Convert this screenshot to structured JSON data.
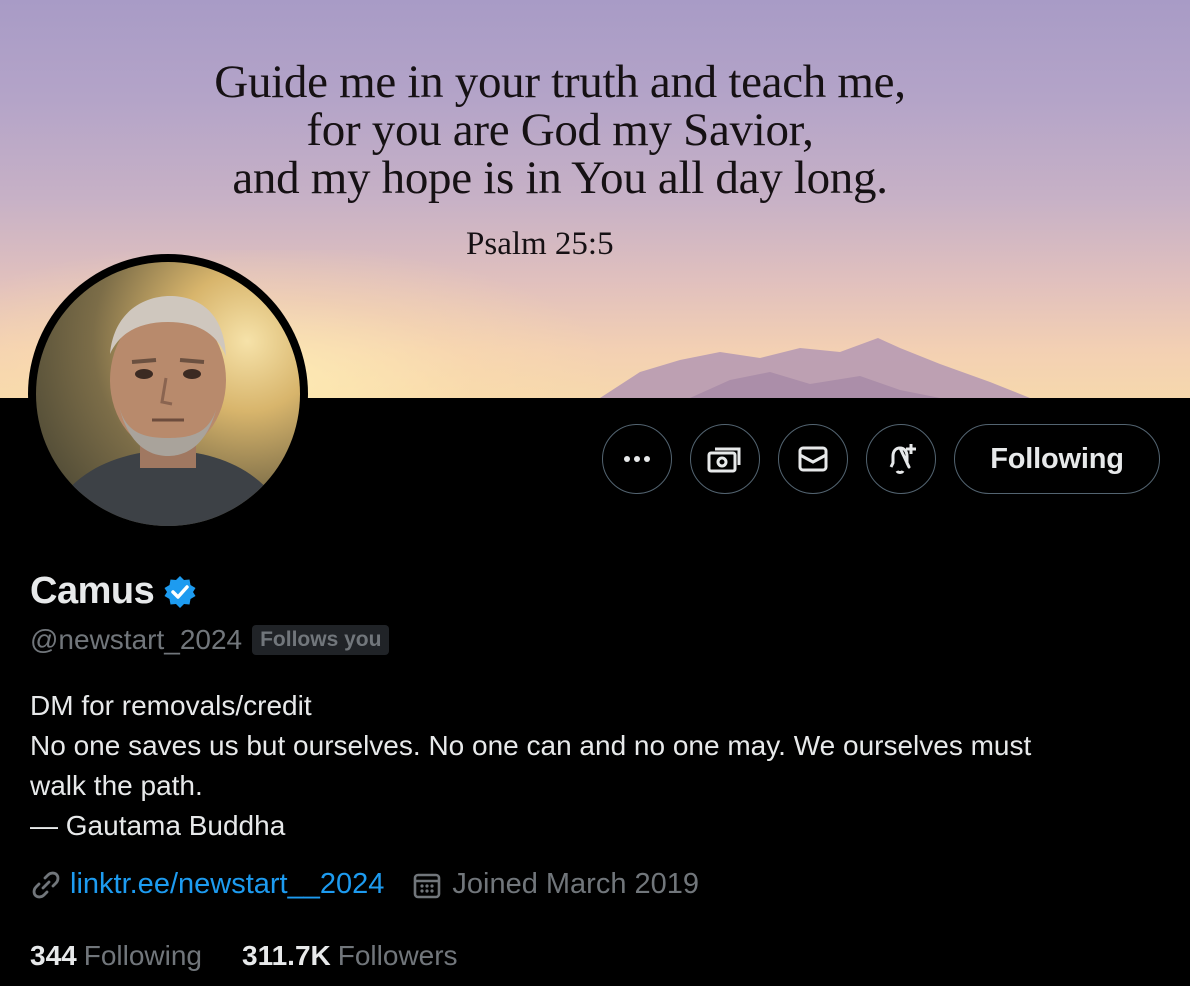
{
  "banner": {
    "quote_lines": [
      "Guide me in your truth and teach me,",
      "for you are God my Savior,",
      "and my hope is in You all day long."
    ],
    "reference": "Psalm 25:5"
  },
  "profile": {
    "display_name": "Camus",
    "verified": true,
    "handle": "@newstart_2024",
    "follows_you_badge": "Follows you",
    "bio_lines": [
      "DM for removals/credit",
      "No one saves us but ourselves. No one can and no one may. We ourselves must",
      "walk the path.",
      "— Gautama Buddha"
    ],
    "website": "linktr.ee/newstart__2024",
    "joined": "Joined March 2019"
  },
  "actions": {
    "more_icon": "more-horizontal-icon",
    "subscribe_icon": "money-icon",
    "message_icon": "envelope-icon",
    "notify_icon": "bell-plus-icon",
    "follow_button_label": "Following"
  },
  "stats": {
    "following_count": "344",
    "following_label": "Following",
    "followers_count": "311.7K",
    "followers_label": "Followers"
  },
  "colors": {
    "background": "#000000",
    "text_primary": "#e7e9ea",
    "text_secondary": "#71767b",
    "link": "#1d9bf0",
    "verified_badge": "#1d9bf0",
    "button_border": "#536471"
  }
}
